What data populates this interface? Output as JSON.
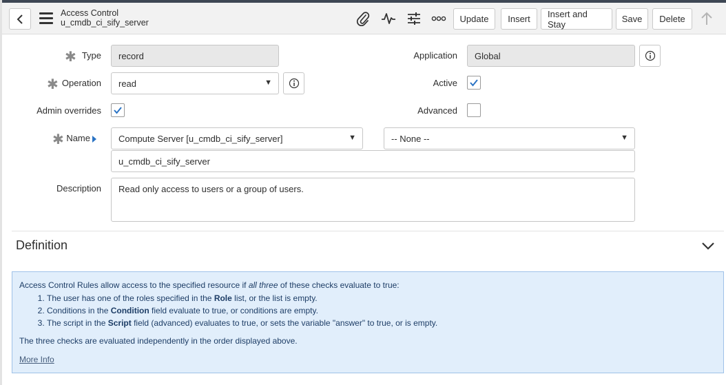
{
  "header": {
    "title": "Access Control",
    "subtitle": "u_cmdb_ci_sify_server",
    "buttons": {
      "update": "Update",
      "insert": "Insert",
      "insert_and_stay": "Insert and Stay",
      "save": "Save",
      "delete": "Delete"
    },
    "icons": [
      "back-icon",
      "menu-icon",
      "paperclip-icon",
      "activity-icon",
      "sliders-icon",
      "more-icon",
      "arrow-up-icon"
    ]
  },
  "form": {
    "type": {
      "label": "Type",
      "value": "record",
      "required": true
    },
    "operation": {
      "label": "Operation",
      "value": "read",
      "required": true
    },
    "admin_overrides": {
      "label": "Admin overrides",
      "checked": true
    },
    "application": {
      "label": "Application",
      "value": "Global"
    },
    "active": {
      "label": "Active",
      "checked": true
    },
    "advanced": {
      "label": "Advanced",
      "checked": false
    },
    "name": {
      "label": "Name",
      "required": true,
      "table_value": "Compute Server [u_cmdb_ci_sify_server]",
      "field_value": "-- None --",
      "text_value": "u_cmdb_ci_sify_server"
    },
    "description": {
      "label": "Description",
      "value": "Read only access to users or a group of users."
    }
  },
  "definition": {
    "title": "Definition",
    "info": {
      "intro_prefix": "Access Control Rules allow access to the specified resource if ",
      "intro_em": "all three",
      "intro_suffix": " of these checks evaluate to true:",
      "items": [
        {
          "pre": "The user has one of the roles specified in the ",
          "bold": "Role",
          "post": " list, or the list is empty."
        },
        {
          "pre": "Conditions in the ",
          "bold": "Condition",
          "post": " field evaluate to true, or conditions are empty."
        },
        {
          "pre": "The script in the ",
          "bold": "Script",
          "post": " field (advanced) evaluates to true, or sets the variable \"answer\" to true, or is empty."
        }
      ],
      "independent": "The three checks are evaluated independently in the order displayed above.",
      "more_info": "More Info"
    }
  },
  "colors": {
    "header_bg": "#f2f2f2",
    "info_bg": "#e1eefb",
    "info_border": "#9ec1e8",
    "check_blue": "#2a73c4"
  }
}
